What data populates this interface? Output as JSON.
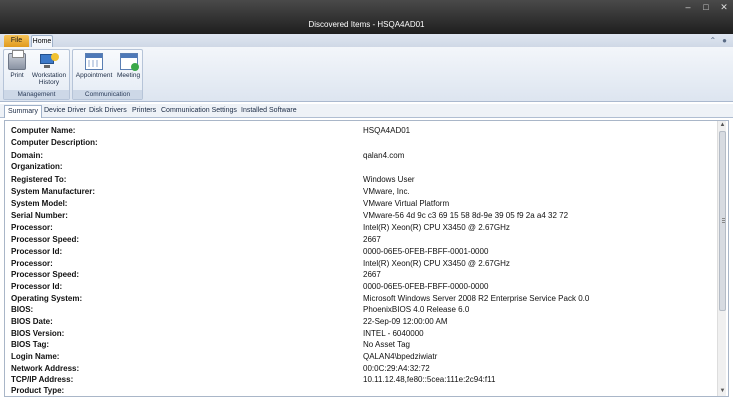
{
  "window": {
    "title": "Discovered Items - HSQA4AD01"
  },
  "ribbon": {
    "tabs": {
      "file": "File",
      "home": "Home"
    },
    "groups": [
      {
        "label": "Management",
        "buttons": [
          {
            "label": "Print",
            "icon": "printer-icon"
          },
          {
            "label": "Workstation History",
            "icon": "workstation-icon"
          }
        ]
      },
      {
        "label": "Communication",
        "buttons": [
          {
            "label": "Appointment",
            "icon": "calendar-icon"
          },
          {
            "label": "Meeting",
            "icon": "meeting-icon"
          }
        ]
      }
    ]
  },
  "tabs": [
    "Summary",
    "Device Driver",
    "Disk Drivers",
    "Printers",
    "Communication Settings",
    "Installed Software"
  ],
  "rows": [
    {
      "label": "Computer Name:",
      "value": "HSQA4AD01"
    },
    {
      "label": "Computer Description:",
      "value": ""
    },
    {
      "label": "Domain:",
      "value": "qalan4.com"
    },
    {
      "label": "Organization:",
      "value": ""
    },
    {
      "label": "Registered To:",
      "value": "Windows User"
    },
    {
      "label": "System Manufacturer:",
      "value": "VMware, Inc."
    },
    {
      "label": "System Model:",
      "value": "VMware Virtual Platform"
    },
    {
      "label": "Serial Number:",
      "value": "VMware-56 4d 9c c3 69 15 58 8d-9e 39 05 f9 2a a4 32 72"
    },
    {
      "label": "Processor:",
      "value": "Intel(R) Xeon(R) CPU X3450 @ 2.67GHz"
    },
    {
      "label": "Processor Speed:",
      "value": "2667"
    },
    {
      "label": "Processor Id:",
      "value": "0000-06E5-0FEB-FBFF-0001-0000"
    },
    {
      "label": "Processor:",
      "value": "Intel(R) Xeon(R) CPU X3450 @ 2.67GHz"
    },
    {
      "label": "Processor Speed:",
      "value": "2667"
    },
    {
      "label": "Processor Id:",
      "value": "0000-06E5-0FEB-FBFF-0000-0000"
    },
    {
      "label": "Operating System:",
      "value": "Microsoft Windows Server 2008 R2 Enterprise Service Pack 0.0"
    },
    {
      "label": "BIOS:",
      "value": "PhoenixBIOS 4.0 Release 6.0"
    },
    {
      "label": "BIOS Date:",
      "value": "22-Sep-09 12:00:00 AM"
    },
    {
      "label": "BIOS Version:",
      "value": "INTEL - 6040000"
    },
    {
      "label": "BIOS Tag:",
      "value": "No Asset Tag"
    },
    {
      "label": "Login Name:",
      "value": "QALAN4\\bpedziwiatr"
    },
    {
      "label": "Network Address:",
      "value": "00:0C:29:A4:32:72"
    },
    {
      "label": "TCP/IP Address:",
      "value": "10.11.12.48,fe80::5cea:111e:2c94:f11"
    },
    {
      "label": "Product Type:",
      "value": ""
    }
  ]
}
